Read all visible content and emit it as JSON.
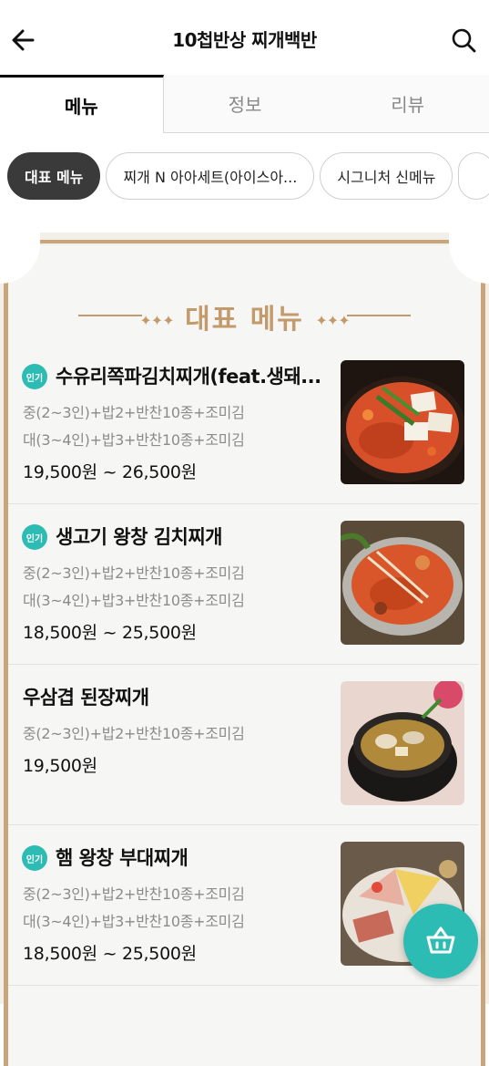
{
  "header": {
    "title": "10첩반상 찌개백반",
    "back_icon": "arrow-left-icon",
    "search_icon": "search-icon"
  },
  "tabs": [
    {
      "label": "메뉴",
      "active": true
    },
    {
      "label": "정보",
      "active": false
    },
    {
      "label": "리뷰",
      "active": false
    }
  ],
  "categories": [
    {
      "label": "대표 메뉴",
      "active": true
    },
    {
      "label": "찌개 N 아아세트(아이스아...",
      "active": false
    },
    {
      "label": "시그니처 신메뉴",
      "active": false
    }
  ],
  "section": {
    "title": "대표 메뉴"
  },
  "menu_items": [
    {
      "badge": "인기",
      "name": "수유리쪽파김치찌개(feat.생돼...",
      "desc1": "중(2~3인)+밥2+반찬10종+조미김",
      "desc2": "대(3~4인)+밥3+반찬10종+조미김",
      "price": "19,500원 ~ 26,500원"
    },
    {
      "badge": "인기",
      "name": "생고기 왕창 김치찌개",
      "desc1": "중(2~3인)+밥2+반찬10종+조미김",
      "desc2": "대(3~4인)+밥3+반찬10종+조미김",
      "price": "18,500원 ~ 25,500원"
    },
    {
      "badge": "",
      "name": "우삼겹 된장찌개",
      "desc1": "중(2~3인)+밥2+반찬10종+조미김",
      "desc2": "",
      "price": "19,500원"
    },
    {
      "badge": "인기",
      "name": "햄 왕창 부대찌개",
      "desc1": "중(2~3인)+밥2+반찬10종+조미김",
      "desc2": "대(3~4인)+밥3+반찬10종+조미김",
      "price": "18,500원 ~ 25,500원"
    }
  ],
  "cart": {
    "icon": "basket-icon"
  },
  "colors": {
    "accent": "#2cbcb4",
    "gold": "#c29a6b",
    "chip_active": "#3a3a3a"
  }
}
